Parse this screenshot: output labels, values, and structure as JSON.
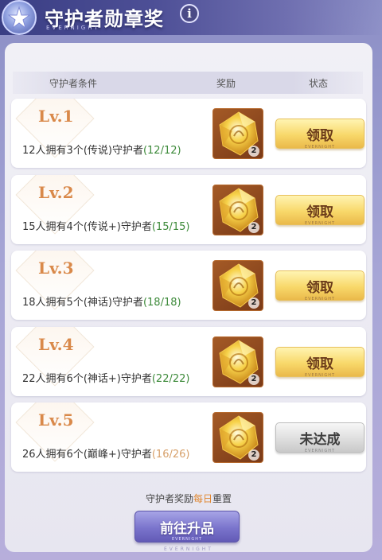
{
  "window": {
    "title": "守护者勋章奖",
    "subtitle": "EVERNIGHT",
    "info_label": "i"
  },
  "table": {
    "headers": {
      "condition": "守护者条件",
      "reward": "奖励",
      "status": "状态"
    }
  },
  "rows": [
    {
      "level": "Lv.1",
      "condition_text": "12人拥有3个(传说)守护者",
      "progress": "(12/12)",
      "reward_count": "2",
      "status": "领取",
      "status_sub": "EVERNIGHT",
      "state": "claimable"
    },
    {
      "level": "Lv.2",
      "condition_text": "15人拥有4个(传说+)守护者",
      "progress": "(15/15)",
      "reward_count": "2",
      "status": "领取",
      "status_sub": "EVERNIGHT",
      "state": "claimable"
    },
    {
      "level": "Lv.3",
      "condition_text": "18人拥有5个(神话)守护者",
      "progress": "(18/18)",
      "reward_count": "2",
      "status": "领取",
      "status_sub": "EVERNIGHT",
      "state": "claimable"
    },
    {
      "level": "Lv.4",
      "condition_text": "22人拥有6个(神话+)守护者",
      "progress": "(22/22)",
      "reward_count": "2",
      "status": "领取",
      "status_sub": "EVERNIGHT",
      "state": "claimable"
    },
    {
      "level": "Lv.5",
      "condition_text": "26人拥有6个(巅峰+)守护者",
      "progress": "(16/26)",
      "reward_count": "2",
      "status": "未达成",
      "status_sub": "EVERNIGHT",
      "state": "not_reached"
    }
  ],
  "footer": {
    "reset_prefix": "守护者奖励",
    "reset_highlight": "每日",
    "reset_suffix": "重置",
    "upgrade_button": "前往升品",
    "upgrade_sub": "EVERNIGHT",
    "watermark": "EVERNIGHT"
  },
  "colors": {
    "accent_gold": "#f8d86a",
    "level_orange": "#d9894a",
    "progress_complete": "#3d8a3a",
    "progress_incomplete": "#d7a06a",
    "upgrade_purple": "#7a74cc"
  },
  "icons": {
    "emblem": "star-emblem-icon",
    "info": "info-icon",
    "reward": "gold-crystal-icon"
  }
}
